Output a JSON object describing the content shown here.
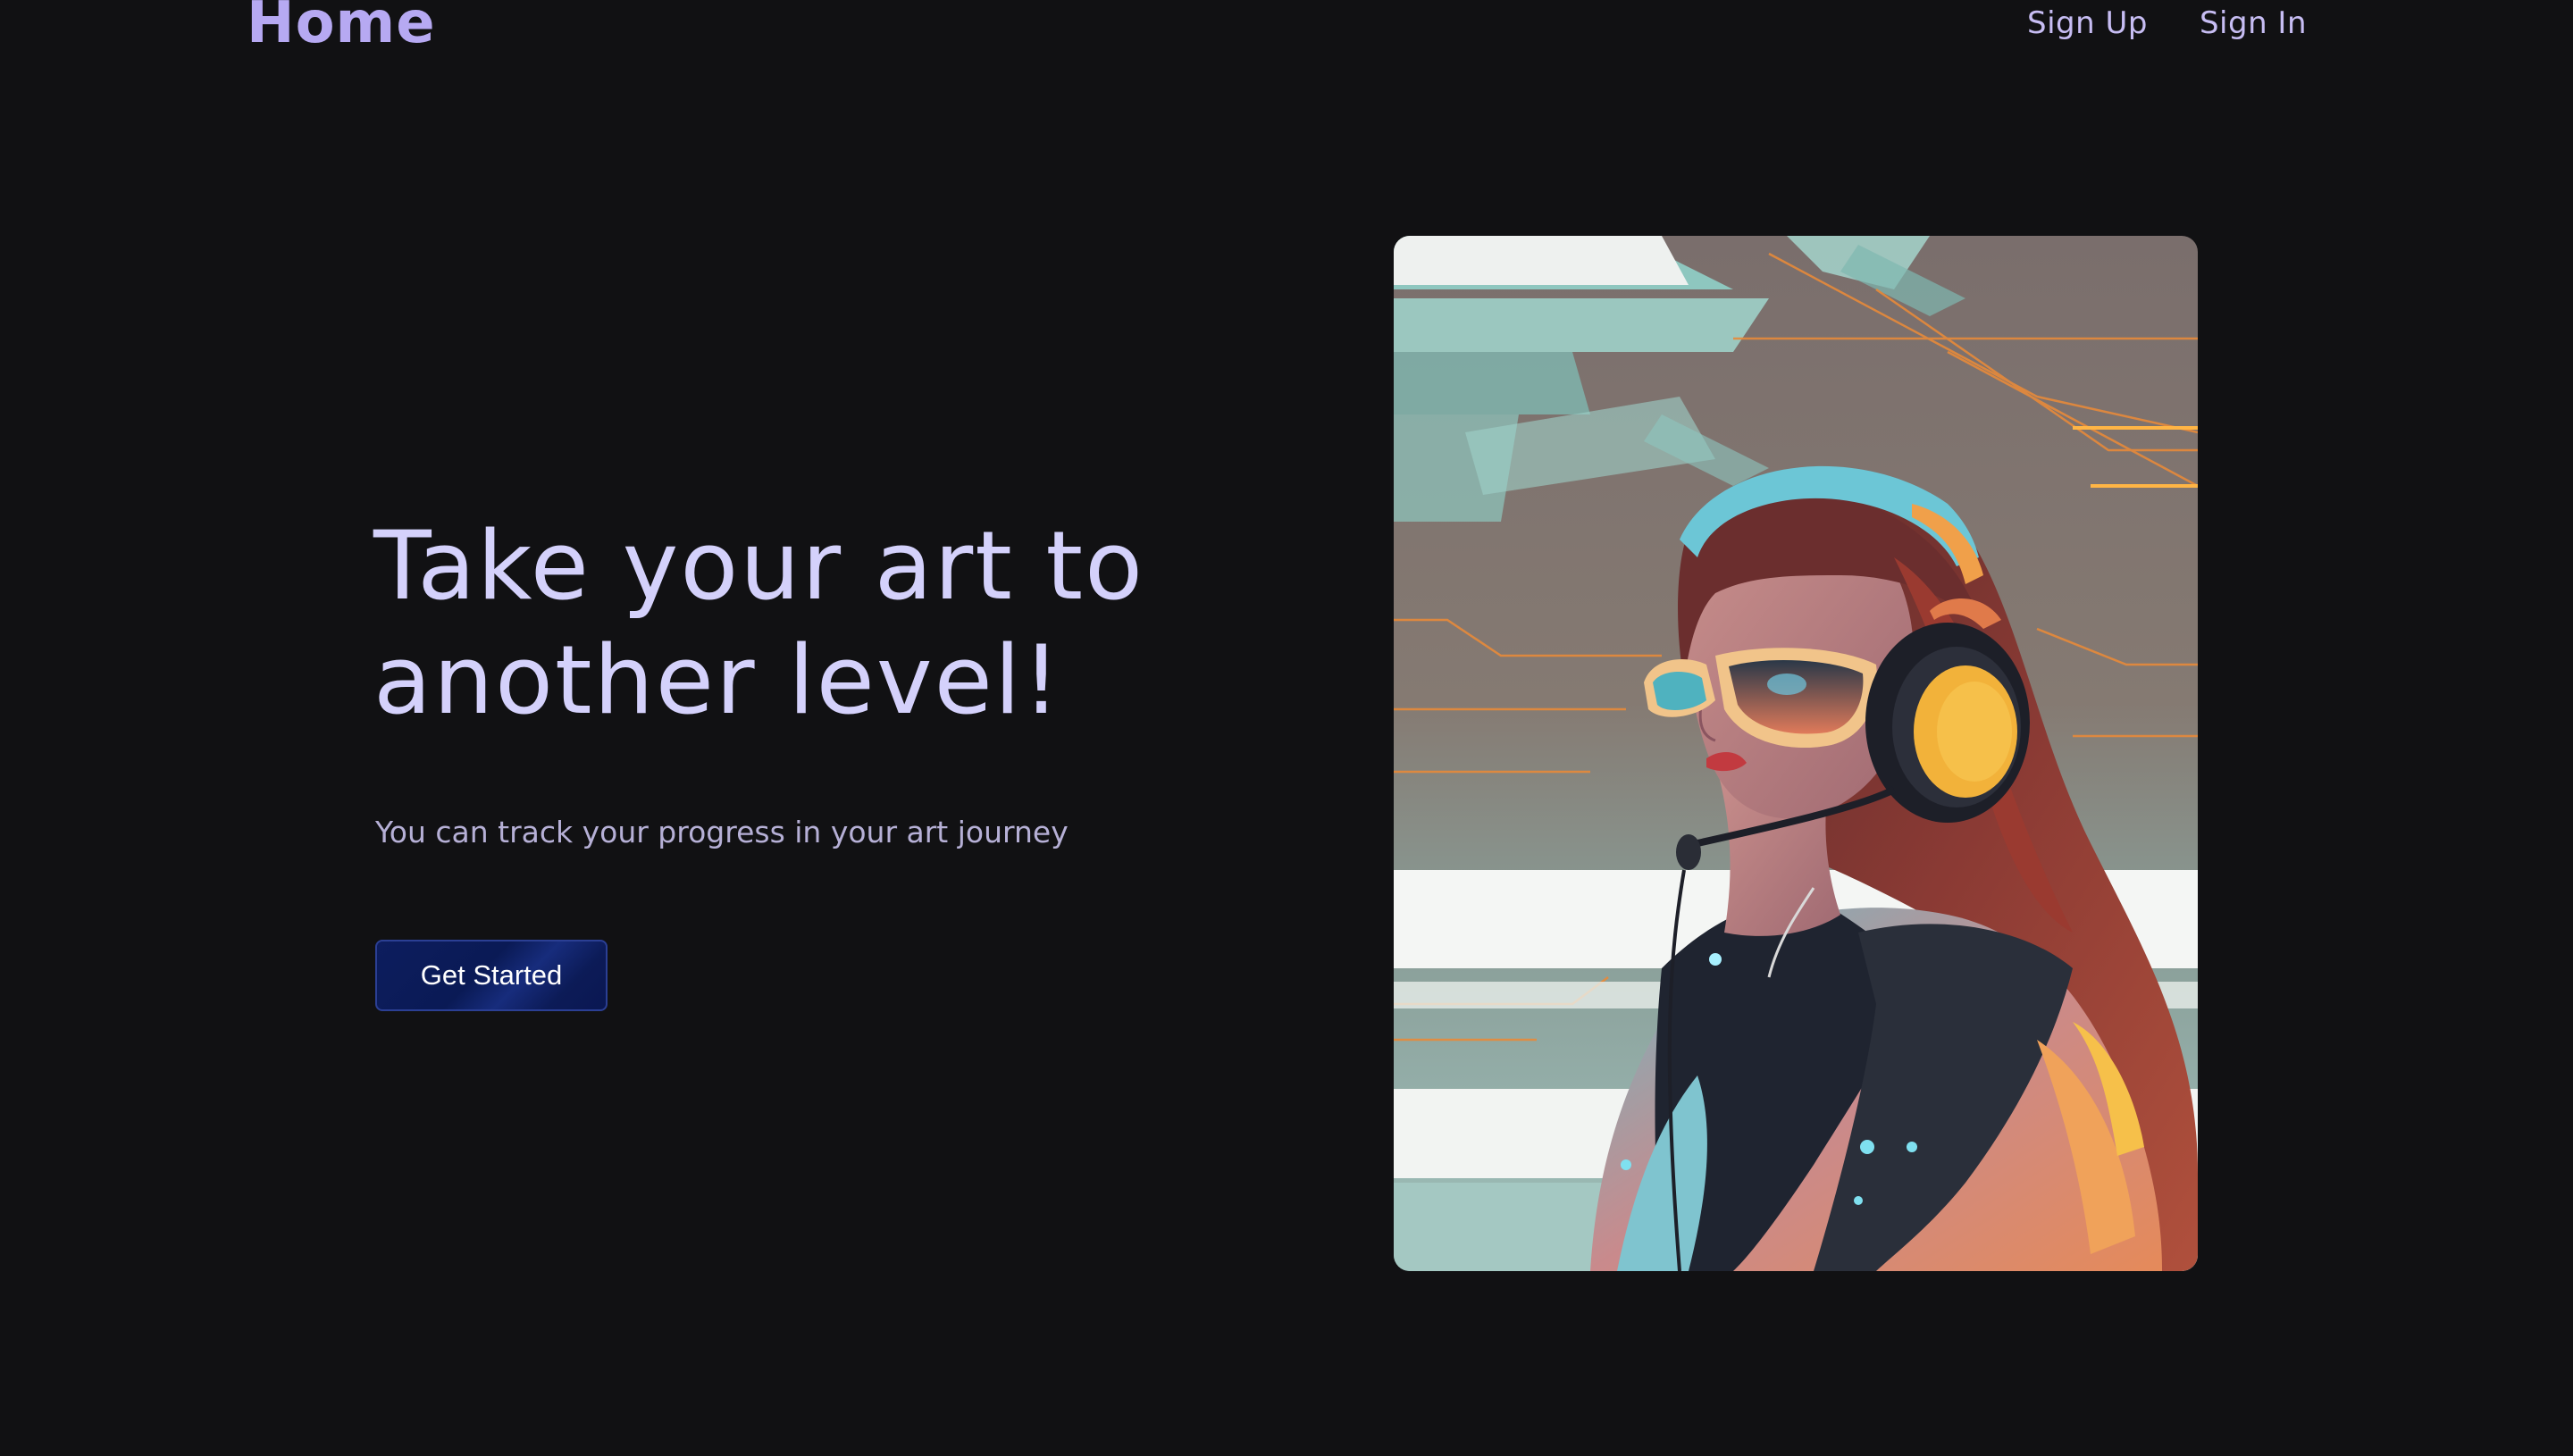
{
  "header": {
    "logo": "Home",
    "nav": [
      {
        "label": "Sign Up"
      },
      {
        "label": "Sign In"
      }
    ]
  },
  "hero": {
    "title": "Take your art to another level!",
    "subtitle": "You can track your progress in your art journey",
    "cta_label": "Get Started"
  },
  "illustration": {
    "icon": "cyberpunk-girl-headphones-illustration"
  },
  "colors": {
    "background": "#111113",
    "logo": "#b6a9f2",
    "nav_text": "#c7bdf3",
    "title": "#d4d1fb",
    "subtitle": "#b6b0d6",
    "button_bg": "#0d1d5e",
    "button_border": "#2b3f94"
  }
}
